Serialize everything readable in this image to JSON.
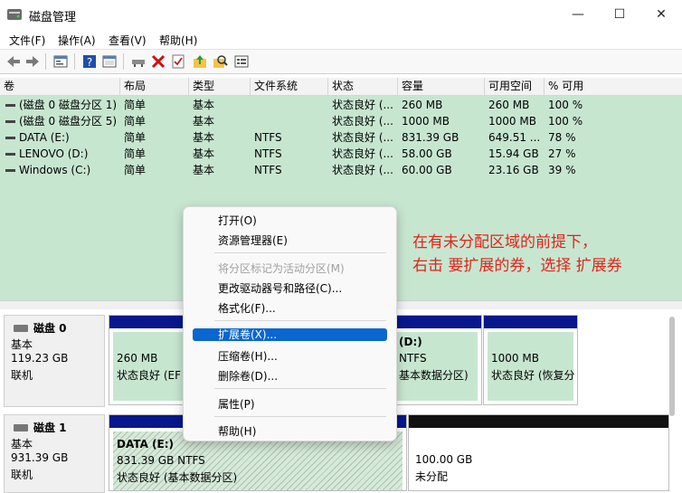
{
  "window": {
    "title": "磁盘管理",
    "minimize": "—",
    "maximize": "☐",
    "close": "✕"
  },
  "menu": [
    "文件(F)",
    "操作(A)",
    "查看(V)",
    "帮助(H)"
  ],
  "toolbar_icons": [
    "back-arrow-icon",
    "forward-arrow-icon",
    "properties-icon",
    "help-icon",
    "console-icon",
    "connect-icon",
    "delete-icon",
    "checklist-icon",
    "folder-up-icon",
    "search-folder-icon",
    "window-list-icon"
  ],
  "volume_table": {
    "columns": [
      "卷",
      "布局",
      "类型",
      "文件系统",
      "状态",
      "容量",
      "可用空间",
      "% 可用"
    ],
    "rows": [
      [
        "(磁盘 0 磁盘分区 1)",
        "简单",
        "基本",
        "",
        "状态良好 (...",
        "260 MB",
        "260 MB",
        "100 %"
      ],
      [
        "(磁盘 0 磁盘分区 5)",
        "简单",
        "基本",
        "",
        "状态良好 (...",
        "1000 MB",
        "1000 MB",
        "100 %"
      ],
      [
        "DATA (E:)",
        "简单",
        "基本",
        "NTFS",
        "状态良好 (...",
        "831.39 GB",
        "649.51 ...",
        "78 %"
      ],
      [
        "LENOVO (D:)",
        "简单",
        "基本",
        "NTFS",
        "状态良好 (...",
        "58.00 GB",
        "15.94 GB",
        "27 %"
      ],
      [
        "Windows (C:)",
        "简单",
        "基本",
        "NTFS",
        "状态良好 (...",
        "60.00 GB",
        "23.16 GB",
        "39 %"
      ]
    ]
  },
  "disks": {
    "disk0": {
      "name": "磁盘 0",
      "type": "基本",
      "size": "119.23 GB",
      "status": "联机"
    },
    "disk1": {
      "name": "磁盘 1",
      "type": "基本",
      "size": "931.39 GB",
      "status": "联机"
    }
  },
  "partitions": {
    "p0_1": {
      "size": "260 MB",
      "status": "状态良好 (EF"
    },
    "p0_3": {
      "title": "(D:)",
      "fs": "NTFS",
      "status": "基本数据分区)"
    },
    "p0_4": {
      "size": "1000 MB",
      "status": "状态良好 (恢复分"
    },
    "p1_1": {
      "title": "DATA  (E:)",
      "fs": "831.39 GB NTFS",
      "status": "状态良好 (基本数据分区)"
    },
    "p1_2": {
      "size": "100.00 GB",
      "status": "未分配"
    }
  },
  "context_menu": {
    "items": [
      "打开(O)",
      "资源管理器(E)",
      "将分区标记为活动分区(M)",
      "更改驱动器号和路径(C)...",
      "格式化(F)...",
      "扩展卷(X)...",
      "压缩卷(H)...",
      "删除卷(D)...",
      "属性(P)",
      "帮助(H)"
    ],
    "disabled_index": 2,
    "highlighted_index": 5
  },
  "annotation": {
    "line1": "在有未分配区域的前提下，",
    "line2": "右击 要扩展的券，选择 扩展券"
  },
  "colors": {
    "volume_bg": "#c7e6d0",
    "partition_bar": "#08178c",
    "highlight": "#0a66d0",
    "annotation": "#e2231a"
  }
}
